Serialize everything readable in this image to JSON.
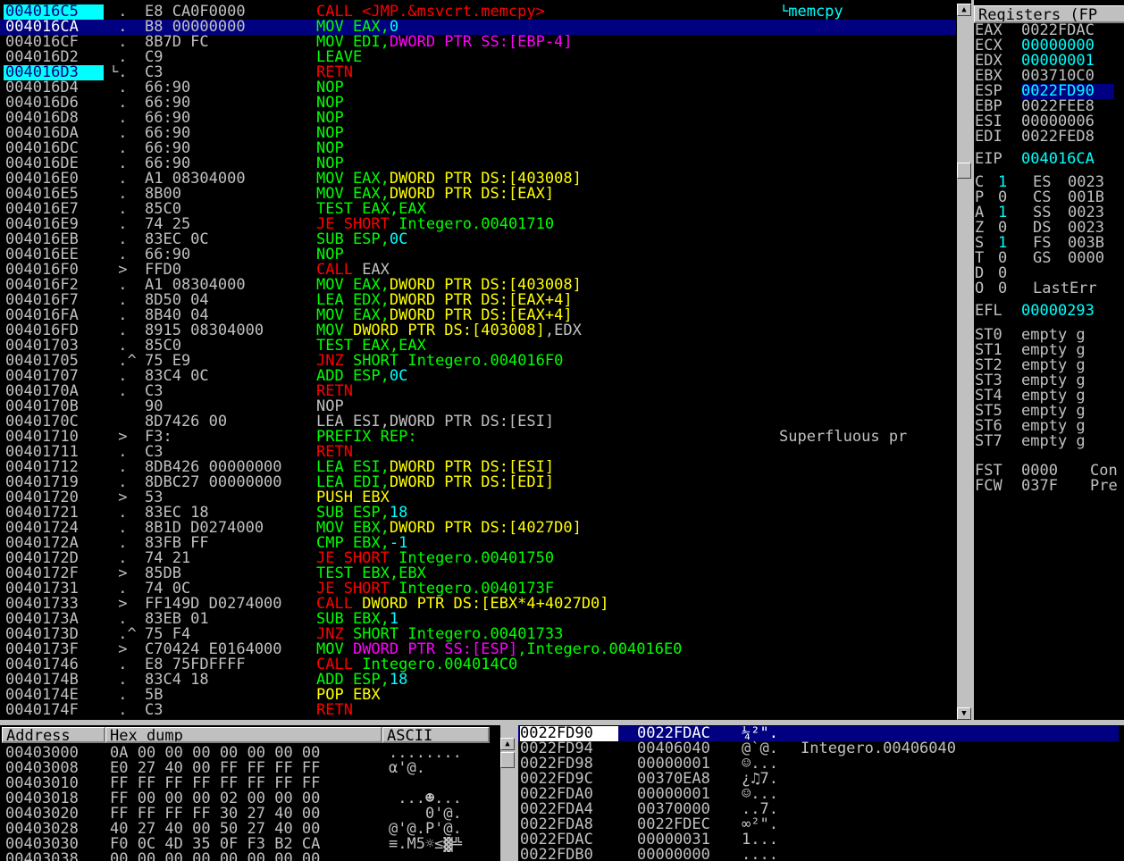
{
  "colors": {
    "call": "#ff0000",
    "mov": "#00ff00",
    "jump": "#ff0000",
    "operand_mem": "#ffff00",
    "operand_imm": "#00ffff",
    "segment": "#ff00ff",
    "text": "#c0c0c0",
    "selection": "#000080",
    "highlight": "#00ffff"
  },
  "disasm": {
    "rows": [
      {
        "addr": "004016C5",
        "mark": " .",
        "hex": "E8 CA0F0000",
        "parts": [
          [
            "CALL <JMP.&msvcrt.memcpy>",
            "#ff0000"
          ]
        ],
        "comment": "└memcpy",
        "addr_hl": true
      },
      {
        "addr": "004016CA",
        "mark": " .",
        "hex": "B8 00000000",
        "parts": [
          [
            "MOV EAX,",
            "#00ff00"
          ],
          [
            "0",
            "#00ffff"
          ]
        ],
        "comment": "",
        "selected": true
      },
      {
        "addr": "004016CF",
        "mark": " .",
        "hex": "8B7D FC",
        "parts": [
          [
            "MOV EDI,",
            "#00ff00"
          ],
          [
            "DWORD PTR SS:[EBP-4]",
            "#ff00ff"
          ]
        ],
        "comment": ""
      },
      {
        "addr": "004016D2",
        "mark": " .",
        "hex": "C9",
        "parts": [
          [
            "LEAVE",
            "#00ff00"
          ]
        ],
        "comment": ""
      },
      {
        "addr": "004016D3",
        "mark": "└.",
        "hex": "C3",
        "parts": [
          [
            "RETN",
            "#ff0000"
          ]
        ],
        "comment": "",
        "addr_hl": true
      },
      {
        "addr": "004016D4",
        "mark": " .",
        "hex": "66:90",
        "parts": [
          [
            "NOP",
            "#00ff00"
          ]
        ],
        "comment": ""
      },
      {
        "addr": "004016D6",
        "mark": " .",
        "hex": "66:90",
        "parts": [
          [
            "NOP",
            "#00ff00"
          ]
        ],
        "comment": ""
      },
      {
        "addr": "004016D8",
        "mark": " .",
        "hex": "66:90",
        "parts": [
          [
            "NOP",
            "#00ff00"
          ]
        ],
        "comment": ""
      },
      {
        "addr": "004016DA",
        "mark": " .",
        "hex": "66:90",
        "parts": [
          [
            "NOP",
            "#00ff00"
          ]
        ],
        "comment": ""
      },
      {
        "addr": "004016DC",
        "mark": " .",
        "hex": "66:90",
        "parts": [
          [
            "NOP",
            "#00ff00"
          ]
        ],
        "comment": ""
      },
      {
        "addr": "004016DE",
        "mark": " .",
        "hex": "66:90",
        "parts": [
          [
            "NOP",
            "#00ff00"
          ]
        ],
        "comment": ""
      },
      {
        "addr": "004016E0",
        "mark": " .",
        "hex": "A1 08304000",
        "parts": [
          [
            "MOV EAX,",
            "#00ff00"
          ],
          [
            "DWORD PTR DS:[403008]",
            "#ffff00"
          ]
        ],
        "comment": ""
      },
      {
        "addr": "004016E5",
        "mark": " .",
        "hex": "8B00",
        "parts": [
          [
            "MOV EAX,",
            "#00ff00"
          ],
          [
            "DWORD PTR DS:[EAX]",
            "#ffff00"
          ]
        ],
        "comment": ""
      },
      {
        "addr": "004016E7",
        "mark": " .",
        "hex": "85C0",
        "parts": [
          [
            "TEST EAX,EAX",
            "#00ff00"
          ]
        ],
        "comment": ""
      },
      {
        "addr": "004016E9",
        "mark": " .",
        "hex": "74 25",
        "parts": [
          [
            "JE SHORT ",
            "#ff0000"
          ],
          [
            "Integero.00401710",
            "#00ff00"
          ]
        ],
        "comment": ""
      },
      {
        "addr": "004016EB",
        "mark": " .",
        "hex": "83EC 0C",
        "parts": [
          [
            "SUB ESP,",
            "#00ff00"
          ],
          [
            "0C",
            "#00ffff"
          ]
        ],
        "comment": ""
      },
      {
        "addr": "004016EE",
        "mark": " .",
        "hex": "66:90",
        "parts": [
          [
            "NOP",
            "#00ff00"
          ]
        ],
        "comment": ""
      },
      {
        "addr": "004016F0",
        "mark": " >",
        "hex": "FFD0",
        "parts": [
          [
            "CALL ",
            "#ff0000"
          ],
          [
            "EAX",
            "#c0c0c0"
          ]
        ],
        "comment": ""
      },
      {
        "addr": "004016F2",
        "mark": " .",
        "hex": "A1 08304000",
        "parts": [
          [
            "MOV EAX,",
            "#00ff00"
          ],
          [
            "DWORD PTR DS:[403008]",
            "#ffff00"
          ]
        ],
        "comment": ""
      },
      {
        "addr": "004016F7",
        "mark": " .",
        "hex": "8D50 04",
        "parts": [
          [
            "LEA EDX,",
            "#00ff00"
          ],
          [
            "DWORD PTR DS:[EAX+4]",
            "#ffff00"
          ]
        ],
        "comment": ""
      },
      {
        "addr": "004016FA",
        "mark": " .",
        "hex": "8B40 04",
        "parts": [
          [
            "MOV EAX,",
            "#00ff00"
          ],
          [
            "DWORD PTR DS:[EAX+4]",
            "#ffff00"
          ]
        ],
        "comment": ""
      },
      {
        "addr": "004016FD",
        "mark": " .",
        "hex": "8915 08304000",
        "parts": [
          [
            "MOV ",
            "#00ff00"
          ],
          [
            "DWORD PTR DS:[403008]",
            "#ffff00"
          ],
          [
            ",EDX",
            "#c0c0c0"
          ]
        ],
        "comment": ""
      },
      {
        "addr": "00401703",
        "mark": " .",
        "hex": "85C0",
        "parts": [
          [
            "TEST EAX,EAX",
            "#00ff00"
          ]
        ],
        "comment": ""
      },
      {
        "addr": "00401705",
        "mark": " .^",
        "hex": "75 E9",
        "parts": [
          [
            "JNZ ",
            "#ff0000"
          ],
          [
            "SHORT ",
            "#00ff00"
          ],
          [
            "Integero.004016F0",
            "#00ff00"
          ]
        ],
        "comment": ""
      },
      {
        "addr": "00401707",
        "mark": " .",
        "hex": "83C4 0C",
        "parts": [
          [
            "ADD ESP,",
            "#00ff00"
          ],
          [
            "0C",
            "#00ffff"
          ]
        ],
        "comment": ""
      },
      {
        "addr": "0040170A",
        "mark": " .",
        "hex": "C3",
        "parts": [
          [
            "RETN",
            "#ff0000"
          ]
        ],
        "comment": ""
      },
      {
        "addr": "0040170B",
        "mark": "",
        "hex": "90",
        "parts": [
          [
            "NOP",
            "#c0c0c0"
          ]
        ],
        "comment": ""
      },
      {
        "addr": "0040170C",
        "mark": "",
        "hex": "8D7426 00",
        "parts": [
          [
            "LEA ESI,DWORD PTR DS:[ESI]",
            "#c0c0c0"
          ]
        ],
        "comment": ""
      },
      {
        "addr": "00401710",
        "mark": " >",
        "hex": "F3:",
        "parts": [
          [
            "PREFIX REP:",
            "#00ff00"
          ]
        ],
        "comment": "Superfluous pr"
      },
      {
        "addr": "00401711",
        "mark": " .",
        "hex": "C3",
        "parts": [
          [
            "RETN",
            "#ff0000"
          ]
        ],
        "comment": ""
      },
      {
        "addr": "00401712",
        "mark": " .",
        "hex": "8DB426 00000000",
        "parts": [
          [
            "LEA ESI,",
            "#00ff00"
          ],
          [
            "DWORD PTR DS:[ESI]",
            "#ffff00"
          ]
        ],
        "comment": ""
      },
      {
        "addr": "00401719",
        "mark": " .",
        "hex": "8DBC27 00000000",
        "parts": [
          [
            "LEA EDI,",
            "#00ff00"
          ],
          [
            "DWORD PTR DS:[EDI]",
            "#ffff00"
          ]
        ],
        "comment": ""
      },
      {
        "addr": "00401720",
        "mark": " >",
        "hex": "53",
        "parts": [
          [
            "PUSH EBX",
            "#ffff00"
          ]
        ],
        "comment": ""
      },
      {
        "addr": "00401721",
        "mark": " .",
        "hex": "83EC 18",
        "parts": [
          [
            "SUB ESP,",
            "#00ff00"
          ],
          [
            "18",
            "#00ffff"
          ]
        ],
        "comment": ""
      },
      {
        "addr": "00401724",
        "mark": " .",
        "hex": "8B1D D0274000",
        "parts": [
          [
            "MOV EBX,",
            "#00ff00"
          ],
          [
            "DWORD PTR DS:[4027D0]",
            "#ffff00"
          ]
        ],
        "comment": ""
      },
      {
        "addr": "0040172A",
        "mark": " .",
        "hex": "83FB FF",
        "parts": [
          [
            "CMP EBX,",
            "#00ff00"
          ],
          [
            "-1",
            "#00ffff"
          ]
        ],
        "comment": ""
      },
      {
        "addr": "0040172D",
        "mark": " .",
        "hex": "74 21",
        "parts": [
          [
            "JE SHORT ",
            "#ff0000"
          ],
          [
            "Integero.00401750",
            "#00ff00"
          ]
        ],
        "comment": ""
      },
      {
        "addr": "0040172F",
        "mark": " >",
        "hex": "85DB",
        "parts": [
          [
            "TEST EBX,EBX",
            "#00ff00"
          ]
        ],
        "comment": ""
      },
      {
        "addr": "00401731",
        "mark": " .",
        "hex": "74 0C",
        "parts": [
          [
            "JE SHORT ",
            "#ff0000"
          ],
          [
            "Integero.0040173F",
            "#00ff00"
          ]
        ],
        "comment": ""
      },
      {
        "addr": "00401733",
        "mark": " >",
        "hex": "FF149D D0274000",
        "parts": [
          [
            "CALL ",
            "#ff0000"
          ],
          [
            "DWORD PTR DS:[EBX*4+4027D0]",
            "#ffff00"
          ]
        ],
        "comment": ""
      },
      {
        "addr": "0040173A",
        "mark": " .",
        "hex": "83EB 01",
        "parts": [
          [
            "SUB EBX,",
            "#00ff00"
          ],
          [
            "1",
            "#00ffff"
          ]
        ],
        "comment": ""
      },
      {
        "addr": "0040173D",
        "mark": " .^",
        "hex": "75 F4",
        "parts": [
          [
            "JNZ ",
            "#ff0000"
          ],
          [
            "SHORT ",
            "#00ff00"
          ],
          [
            "Integero.00401733",
            "#00ff00"
          ]
        ],
        "comment": ""
      },
      {
        "addr": "0040173F",
        "mark": " >",
        "hex": "C70424 E0164000",
        "parts": [
          [
            "MOV ",
            "#00ff00"
          ],
          [
            "DWORD PTR SS:[ESP]",
            "#ff00ff"
          ],
          [
            ",Integero.004016E0",
            "#00ff00"
          ]
        ],
        "comment": ""
      },
      {
        "addr": "00401746",
        "mark": " .",
        "hex": "E8 75FDFFFF",
        "parts": [
          [
            "CALL ",
            "#ff0000"
          ],
          [
            "Integero.004014C0",
            "#00ff00"
          ]
        ],
        "comment": ""
      },
      {
        "addr": "0040174B",
        "mark": " .",
        "hex": "83C4 18",
        "parts": [
          [
            "ADD ESP,",
            "#00ff00"
          ],
          [
            "18",
            "#00ffff"
          ]
        ],
        "comment": ""
      },
      {
        "addr": "0040174E",
        "mark": " .",
        "hex": "5B",
        "parts": [
          [
            "POP EBX",
            "#ffff00"
          ]
        ],
        "comment": ""
      },
      {
        "addr": "0040174F",
        "mark": " .",
        "hex": "C3",
        "parts": [
          [
            "RETN",
            "#ff0000"
          ]
        ],
        "comment": ""
      }
    ]
  },
  "registers": {
    "title": "Registers (FP",
    "gp": [
      {
        "name": "EAX",
        "value": "0022FDAC",
        "color": "#c0c0c0"
      },
      {
        "name": "ECX",
        "value": "00000000",
        "color": "#00ffff"
      },
      {
        "name": "EDX",
        "value": "00000001",
        "color": "#00ffff"
      },
      {
        "name": "EBX",
        "value": "003710C0",
        "color": "#c0c0c0"
      },
      {
        "name": "ESP",
        "value": "0022FD90",
        "color": "#00ffff",
        "selected": true
      },
      {
        "name": "EBP",
        "value": "0022FEE8",
        "color": "#c0c0c0"
      },
      {
        "name": "ESI",
        "value": "00000006",
        "color": "#c0c0c0"
      },
      {
        "name": "EDI",
        "value": "0022FED8",
        "color": "#c0c0c0"
      }
    ],
    "eip": {
      "name": "EIP",
      "value": "004016CA"
    },
    "flags": [
      {
        "f": "C",
        "v": "1",
        "vc": "#00ffff",
        "seg": "ES",
        "sv": "0023"
      },
      {
        "f": "P",
        "v": "0",
        "vc": "#c0c0c0",
        "seg": "CS",
        "sv": "001B"
      },
      {
        "f": "A",
        "v": "1",
        "vc": "#00ffff",
        "seg": "SS",
        "sv": "0023"
      },
      {
        "f": "Z",
        "v": "0",
        "vc": "#c0c0c0",
        "seg": "DS",
        "sv": "0023"
      },
      {
        "f": "S",
        "v": "1",
        "vc": "#00ffff",
        "seg": "FS",
        "sv": "003B"
      },
      {
        "f": "T",
        "v": "0",
        "vc": "#c0c0c0",
        "seg": "GS",
        "sv": "0000"
      },
      {
        "f": "D",
        "v": "0",
        "vc": "#c0c0c0",
        "seg": "",
        "sv": ""
      },
      {
        "f": "O",
        "v": "0",
        "vc": "#c0c0c0",
        "seg": "LastErr",
        "sv": ""
      }
    ],
    "efl": {
      "name": "EFL",
      "value": "00000293"
    },
    "fpu": [
      {
        "name": "ST0",
        "value": "empty g"
      },
      {
        "name": "ST1",
        "value": "empty g"
      },
      {
        "name": "ST2",
        "value": "empty g"
      },
      {
        "name": "ST3",
        "value": "empty g"
      },
      {
        "name": "ST4",
        "value": "empty g"
      },
      {
        "name": "ST5",
        "value": "empty g"
      },
      {
        "name": "ST6",
        "value": "empty g"
      },
      {
        "name": "ST7",
        "value": "empty g"
      }
    ],
    "fst": {
      "name": "FST",
      "value": "0000",
      "extra": "Con"
    },
    "fcw": {
      "name": "FCW",
      "value": "037F",
      "extra": "Pre"
    }
  },
  "dump": {
    "headers": {
      "address": "Address",
      "hex": "Hex dump",
      "ascii": "ASCII"
    },
    "rows": [
      {
        "addr": "00403000",
        "hex": "0A 00 00 00 00 00 00 00",
        "ascii": "........"
      },
      {
        "addr": "00403008",
        "hex": "E0 27 40 00 FF FF FF FF",
        "ascii": "α'@.    "
      },
      {
        "addr": "00403010",
        "hex": "FF FF FF FF FF FF FF FF",
        "ascii": "        "
      },
      {
        "addr": "00403018",
        "hex": "FF 00 00 00 02 00 00 00",
        "ascii": " ...☻..."
      },
      {
        "addr": "00403020",
        "hex": "FF FF FF FF 30 27 40 00",
        "ascii": "    0'@."
      },
      {
        "addr": "00403028",
        "hex": "40 27 40 00 50 27 40 00",
        "ascii": "@'@.P'@."
      },
      {
        "addr": "00403030",
        "hex": "F0 0C 4D 35 0F F3 B2 CA",
        "ascii": "≡.M5☼≤▓╩"
      },
      {
        "addr": "00403038",
        "hex": "00 00 00 00 00 00 00 00",
        "ascii": "........"
      }
    ]
  },
  "stack": {
    "rows": [
      {
        "addr": "0022FD90",
        "value": "0022FDAC",
        "ascii": "¼²\".",
        "comment": "",
        "selected": true
      },
      {
        "addr": "0022FD94",
        "value": "00406040",
        "ascii": "@`@.",
        "comment": "Integero.00406040"
      },
      {
        "addr": "0022FD98",
        "value": "00000001",
        "ascii": "☺...",
        "comment": ""
      },
      {
        "addr": "0022FD9C",
        "value": "00370EA8",
        "ascii": "¿♫7.",
        "comment": ""
      },
      {
        "addr": "0022FDA0",
        "value": "00000001",
        "ascii": "☺...",
        "comment": ""
      },
      {
        "addr": "0022FDA4",
        "value": "00370000",
        "ascii": "..7.",
        "comment": ""
      },
      {
        "addr": "0022FDA8",
        "value": "0022FDEC",
        "ascii": "∞²\".",
        "comment": ""
      },
      {
        "addr": "0022FDAC",
        "value": "00000031",
        "ascii": "1...",
        "comment": ""
      },
      {
        "addr": "0022FDB0",
        "value": "00000000",
        "ascii": "....",
        "comment": ""
      }
    ]
  }
}
